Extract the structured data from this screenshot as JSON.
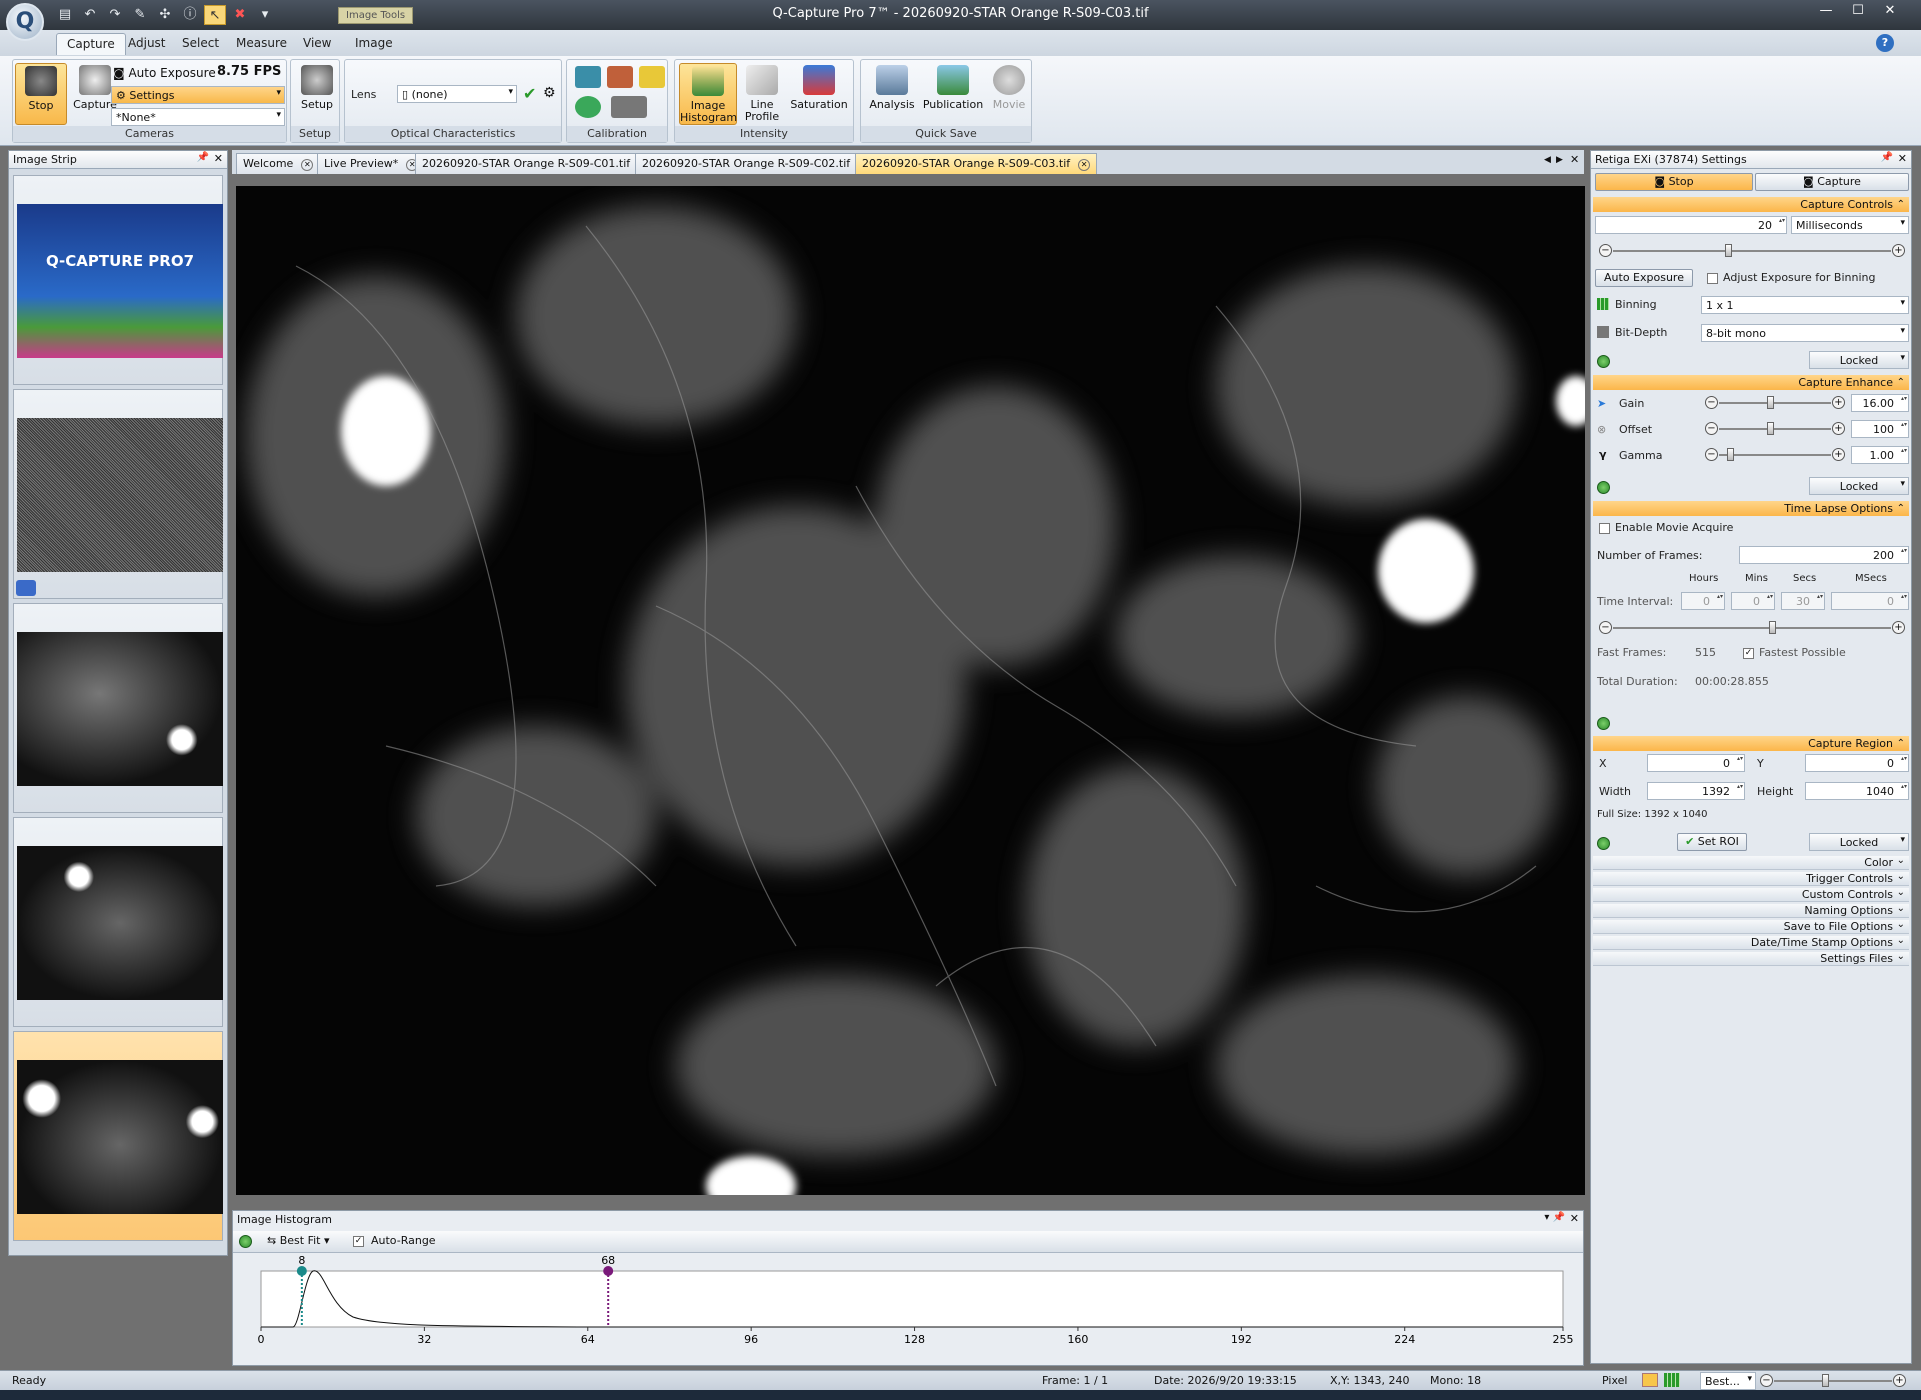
{
  "window": {
    "title": "Q-Capture Pro 7™ - 20260920-STAR Orange R-S09-C03.tif",
    "context_tab": "Image Tools"
  },
  "ribbon": {
    "tabs": [
      "Capture",
      "Adjust",
      "Select",
      "Measure",
      "View",
      "Image"
    ],
    "active_tab": "Capture",
    "cameras": {
      "stop": "Stop",
      "capture": "Capture",
      "auto_exposure": "Auto Exposure",
      "fps": "8.75 FPS",
      "settings": "Settings",
      "preset": "*None*",
      "label": "Cameras"
    },
    "setup": {
      "button": "Setup",
      "label": "Setup"
    },
    "optical": {
      "lens_label": "Lens",
      "lens_value": "(none)",
      "label": "Optical Characteristics"
    },
    "calibration": {
      "label": "Calibration"
    },
    "intensity": {
      "histogram": "Image Histogram",
      "line_profile": "Line Profile",
      "saturation": "Saturation",
      "label": "Intensity"
    },
    "quick_save": {
      "analysis": "Analysis",
      "publication": "Publication",
      "movie": "Movie",
      "label": "Quick Save"
    }
  },
  "strip": {
    "title": "Image Strip",
    "logo_text": "Q-CAPTURE PRO7"
  },
  "doc_tabs": [
    "Welcome",
    "Live Preview*",
    "20260920-STAR Orange R-S09-C01.tif",
    "20260920-STAR Orange R-S09-C02.tif",
    "20260920-STAR Orange R-S09-C03.tif"
  ],
  "histogram": {
    "title": "Image Histogram",
    "fit": "Best Fit",
    "auto_range": "Auto-Range",
    "min_marker": "8",
    "max_marker": "68",
    "ticks": [
      "0",
      "32",
      "64",
      "96",
      "128",
      "160",
      "192",
      "224",
      "255"
    ],
    "min_value": 8,
    "max_value": 68,
    "range_max": 255
  },
  "settings": {
    "title": "Retiga EXi (37874) Settings",
    "stop": "Stop",
    "capture": "Capture",
    "capture_controls": {
      "header": "Capture Controls",
      "exposure": "20",
      "unit": "Milliseconds",
      "auto_exposure": "Auto Exposure",
      "adjust_binning": "Adjust Exposure for Binning",
      "binning_label": "Binning",
      "binning": "1 x 1",
      "bitdepth_label": "Bit-Depth",
      "bitdepth": "8-bit mono",
      "locked": "Locked"
    },
    "enhance": {
      "header": "Capture Enhance",
      "gain_label": "Gain",
      "gain": "16.00",
      "offset_label": "Offset",
      "offset": "100",
      "gamma_label": "Gamma",
      "gamma": "1.00",
      "locked": "Locked"
    },
    "timelapse": {
      "header": "Time Lapse Options",
      "enable": "Enable Movie Acquire",
      "frames_label": "Number of Frames:",
      "frames": "200",
      "hours": "Hours",
      "mins": "Mins",
      "secs": "Secs",
      "msecs": "MSecs",
      "interval_label": "Time Interval:",
      "h": "0",
      "m": "0",
      "s": "30",
      "ms": "0",
      "fast_label": "Fast Frames:",
      "fast": "515",
      "fastest": "Fastest Possible",
      "duration_label": "Total Duration:",
      "duration": "00:00:28.855"
    },
    "region": {
      "header": "Capture Region",
      "x_label": "X",
      "x": "0",
      "y_label": "Y",
      "y": "0",
      "w_label": "Width",
      "w": "1392",
      "h_label": "Height",
      "h": "1040",
      "full": "Full Size: 1392 x 1040",
      "set_roi": "Set ROI",
      "locked": "Locked"
    },
    "collapsed": [
      "Color",
      "Trigger Controls",
      "Custom Controls",
      "Naming Options",
      "Save to File Options",
      "Date/Time Stamp Options",
      "Settings Files"
    ]
  },
  "status": {
    "ready": "Ready",
    "frame": "Frame: 1 / 1",
    "date": "Date: 2026/9/20 19:33:15",
    "xy": "X,Y: 1343,  240",
    "mono": "Mono:   18",
    "unit": "Pixel",
    "zoom": "Best..."
  },
  "colors": {
    "accent": "#fbb64a",
    "ribbon": "#dfe6ee",
    "min_marker": "#1a8a8a",
    "max_marker": "#7a1a7a"
  }
}
